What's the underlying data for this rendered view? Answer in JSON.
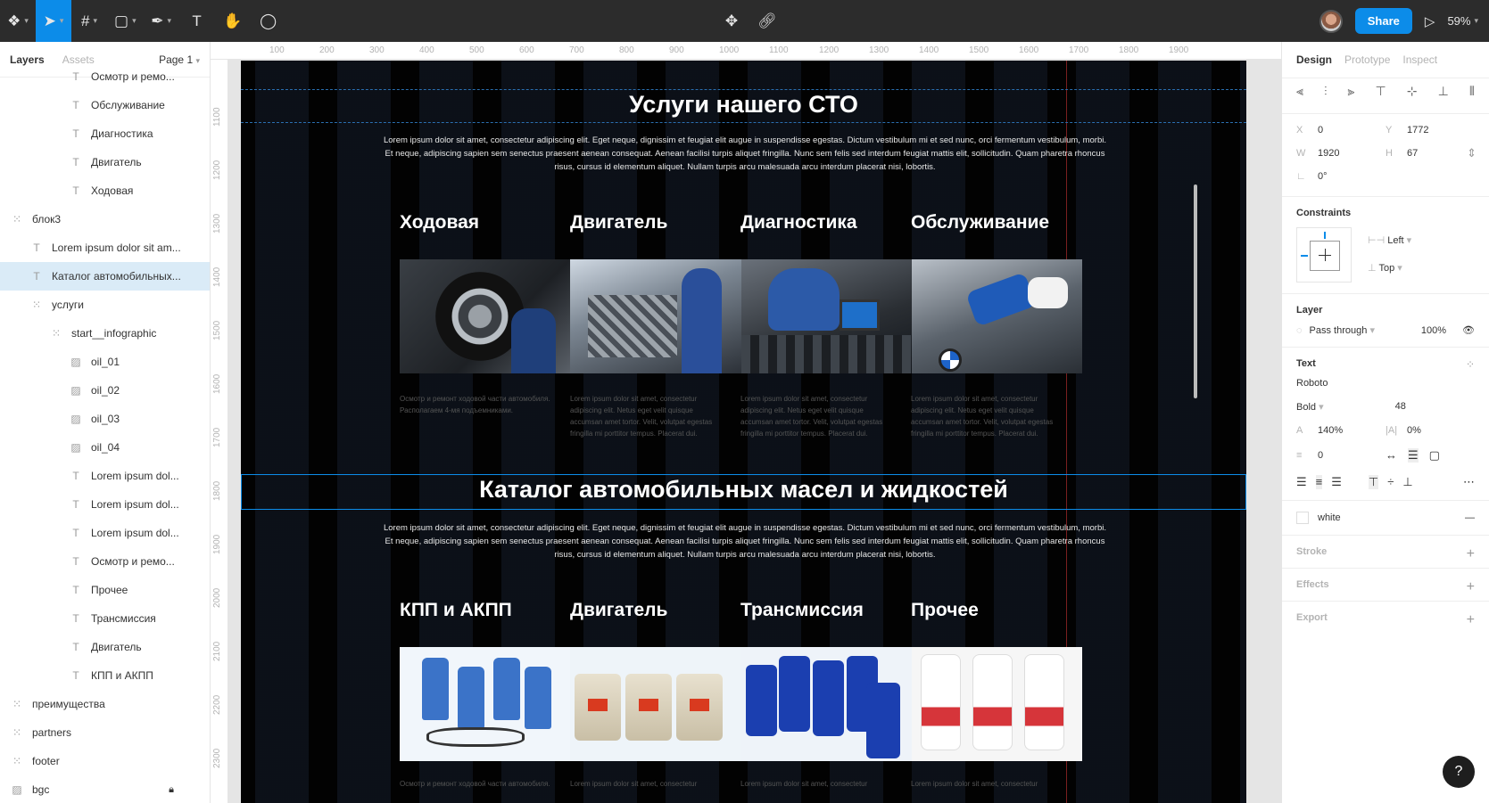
{
  "toolbar": {
    "zoom": "59%",
    "share_label": "Share"
  },
  "left_panel": {
    "tabs": [
      "Layers",
      "Assets"
    ],
    "page": "Page 1",
    "layers": [
      {
        "label": "Осмотр и ремо...",
        "type": "text",
        "indent": 4
      },
      {
        "label": "Обслуживание",
        "type": "text",
        "indent": 4
      },
      {
        "label": "Диагностика",
        "type": "text",
        "indent": 4
      },
      {
        "label": "Двигатель",
        "type": "text",
        "indent": 4
      },
      {
        "label": "Ходовая",
        "type": "text",
        "indent": 4
      },
      {
        "label": "блок3",
        "type": "frame",
        "indent": 1
      },
      {
        "label": "Lorem ipsum dolor sit am...",
        "type": "text",
        "indent": 2
      },
      {
        "label": "Каталог автомобильных...",
        "type": "text",
        "indent": 2,
        "selected": true
      },
      {
        "label": "услуги",
        "type": "frame",
        "indent": 2
      },
      {
        "label": "start__infographic",
        "type": "frame",
        "indent": 3
      },
      {
        "label": "oil_01",
        "type": "image",
        "indent": 4
      },
      {
        "label": "oil_02",
        "type": "image",
        "indent": 4
      },
      {
        "label": "oil_03",
        "type": "image",
        "indent": 4
      },
      {
        "label": "oil_04",
        "type": "image",
        "indent": 4
      },
      {
        "label": "Lorem ipsum dol...",
        "type": "text",
        "indent": 4
      },
      {
        "label": "Lorem ipsum dol...",
        "type": "text",
        "indent": 4
      },
      {
        "label": "Lorem ipsum dol...",
        "type": "text",
        "indent": 4
      },
      {
        "label": "Осмотр и ремо...",
        "type": "text",
        "indent": 4
      },
      {
        "label": "Прочее",
        "type": "text",
        "indent": 4
      },
      {
        "label": "Трансмиссия",
        "type": "text",
        "indent": 4
      },
      {
        "label": "Двигатель",
        "type": "text",
        "indent": 4
      },
      {
        "label": "КПП и АКПП",
        "type": "text",
        "indent": 4
      },
      {
        "label": "преимущества",
        "type": "frame",
        "indent": 1
      },
      {
        "label": "partners",
        "type": "frame",
        "indent": 1
      },
      {
        "label": "footer",
        "type": "frame",
        "indent": 1
      },
      {
        "label": "bgc",
        "type": "image",
        "indent": 1,
        "locked": true
      }
    ]
  },
  "canvas": {
    "ruler_top": [
      "100",
      "200",
      "300",
      "400",
      "500",
      "600",
      "700",
      "800",
      "900",
      "1000",
      "1100",
      "1200",
      "1300",
      "1400",
      "1500",
      "1600",
      "1700",
      "1800",
      "1900"
    ],
    "ruler_left": [
      "1100",
      "1200",
      "1300",
      "1400",
      "1500",
      "1600",
      "1700",
      "1800",
      "1900",
      "2000",
      "2100",
      "2200",
      "2300"
    ],
    "section1": {
      "title": "Услуги нашего СТО",
      "desc": "Lorem ipsum dolor sit amet, consectetur adipiscing elit. Eget neque, dignissim et feugiat elit augue in suspendisse egestas. Dictum vestibulum mi et sed nunc, orci fermentum vestibulum, morbi. Et neque, adipiscing sapien sem senectus praesent aenean consequat. Aenean facilisi turpis aliquet fringilla. Nunc sem felis sed interdum feugiat mattis elit, sollicitudin. Quam pharetra rhoncus risus, cursus id elementum aliquet. Nullam turpis arcu malesuada arcu interdum placerat nisi, lobortis.",
      "categories": [
        "Ходовая",
        "Двигатель",
        "Диагностика",
        "Обслуживание"
      ],
      "captions": [
        "Осмотр и ремонт ходовой части автомобиля. Располагаем 4-мя подъемниками.",
        "Lorem ipsum dolor sit amet, consectetur adipiscing elit. Netus eget velit quisque accumsan amet tortor. Velit, volutpat egestas fringilla mi porttitor tempus. Placerat dui.",
        "Lorem ipsum dolor sit amet, consectetur adipiscing elit. Netus eget velit quisque accumsan amet tortor. Velit, volutpat egestas fringilla mi porttitor tempus. Placerat dui.",
        "Lorem ipsum dolor sit amet, consectetur adipiscing elit. Netus eget velit quisque accumsan amet tortor. Velit, volutpat egestas fringilla mi porttitor tempus. Placerat dui."
      ]
    },
    "section2": {
      "title": "Каталог автомобильных масел и жидкостей",
      "desc": "Lorem ipsum dolor sit amet, consectetur adipiscing elit. Eget neque, dignissim et feugiat elit augue in suspendisse egestas. Dictum vestibulum mi et sed nunc, orci fermentum vestibulum, morbi. Et neque, adipiscing sapien sem senectus praesent aenean consequat. Aenean facilisi turpis aliquet fringilla. Nunc sem felis sed interdum feugiat mattis elit, sollicitudin. Quam pharetra rhoncus risus, cursus id elementum aliquet. Nullam turpis arcu malesuada arcu interdum placerat nisi, lobortis.",
      "categories": [
        "КПП и АКПП",
        "Двигатель",
        "Трансмиссия",
        "Прочее"
      ],
      "captions": [
        "Осмотр и ремонт ходовой части автомобиля.",
        "Lorem ipsum dolor sit amet, consectetur",
        "Lorem ipsum dolor sit amet, consectetur",
        "Lorem ipsum dolor sit amet, consectetur"
      ]
    }
  },
  "right_panel": {
    "tabs": [
      "Design",
      "Prototype",
      "Inspect"
    ],
    "x": "0",
    "y": "1772",
    "w": "1920",
    "h": "67",
    "rotation": "0°",
    "constraints_title": "Constraints",
    "constraint_h": "Left",
    "constraint_v": "Top",
    "layer_title": "Layer",
    "blend": "Pass through",
    "opacity": "100%",
    "text_title": "Text",
    "font": "Roboto",
    "weight": "Bold",
    "size": "48",
    "line_height": "140%",
    "letter_spacing": "0%",
    "para_spacing": "0",
    "fill": "white",
    "stroke": "Stroke",
    "effects": "Effects",
    "export": "Export"
  },
  "colors": {
    "accent": "#0c8ce9",
    "toolbar": "#2c2c2c",
    "frame_bg": "#020202"
  }
}
